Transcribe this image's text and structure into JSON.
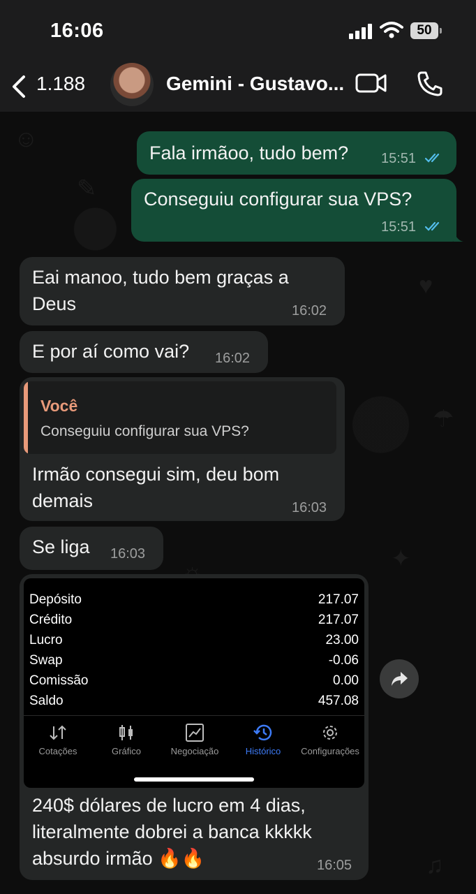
{
  "status_bar": {
    "time": "16:06",
    "battery": "50"
  },
  "header": {
    "back_count": "1.188",
    "contact_name": "Gemini - Gustavo..."
  },
  "messages": [
    {
      "direction": "out",
      "text": "Fala irmãoo, tudo bem?",
      "time": "15:51",
      "status": "read"
    },
    {
      "direction": "out",
      "text": "Conseguiu configurar sua VPS?",
      "time": "15:51",
      "status": "read"
    },
    {
      "direction": "in",
      "text": "Eai manoo, tudo bem graças a Deus",
      "time": "16:02"
    },
    {
      "direction": "in",
      "text": "E por aí como vai?",
      "time": "16:02"
    },
    {
      "direction": "in",
      "reply_to": {
        "author": "Você",
        "text": "Conseguiu configurar sua VPS?"
      },
      "text": "Irmão consegui sim, deu bom demais",
      "time": "16:03"
    },
    {
      "direction": "in",
      "text": "Se liga",
      "time": "16:03"
    },
    {
      "direction": "in",
      "text": "240$ dólares de lucro em 4 dias, literalmente dobrei a banca kkkkk absurdo irmão 🔥🔥",
      "time": "16:05",
      "image": {
        "account": [
          {
            "label": "Depósito",
            "value": "217.07"
          },
          {
            "label": "Crédito",
            "value": "217.07"
          },
          {
            "label": "Lucro",
            "value": "23.00"
          },
          {
            "label": "Swap",
            "value": "-0.06"
          },
          {
            "label": "Comissão",
            "value": "0.00"
          },
          {
            "label": "Saldo",
            "value": "457.08"
          }
        ],
        "tabs": [
          {
            "label": "Cotações",
            "icon": "quotes-icon",
            "active": false
          },
          {
            "label": "Gráfico",
            "icon": "chart-icon",
            "active": false
          },
          {
            "label": "Negociação",
            "icon": "trade-icon",
            "active": false
          },
          {
            "label": "Histórico",
            "icon": "history-icon",
            "active": true
          },
          {
            "label": "Configurações",
            "icon": "settings-icon",
            "active": false
          }
        ]
      }
    }
  ],
  "colors": {
    "outgoing": "#144d37",
    "incoming": "#242626",
    "quote_accent": "#e89a7a",
    "read_ticks": "#53bdeb",
    "active_tab": "#3d7bf7"
  }
}
